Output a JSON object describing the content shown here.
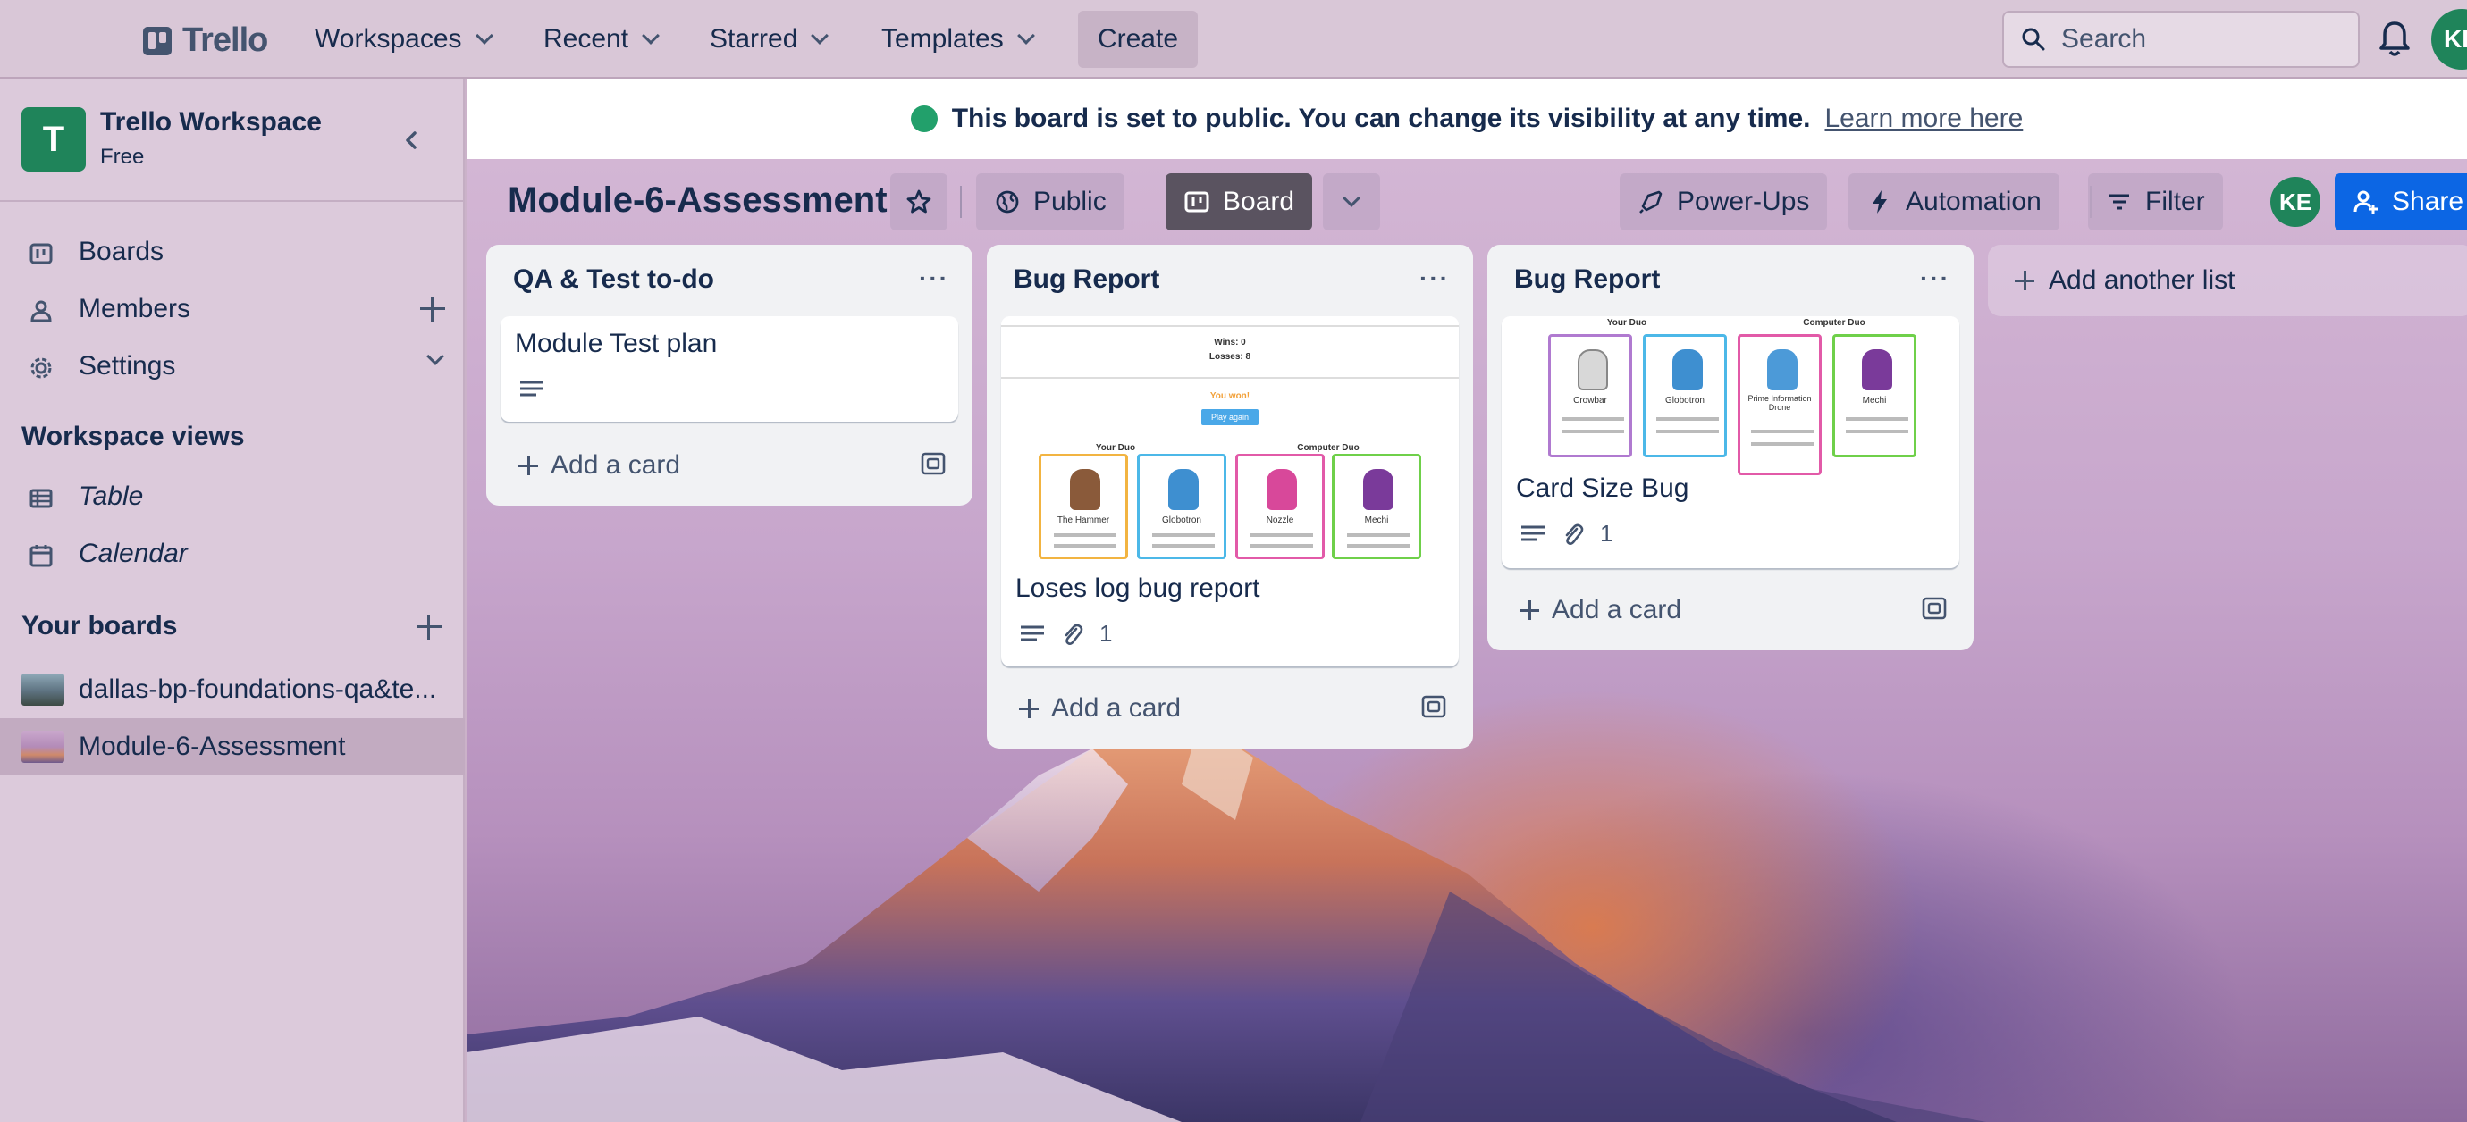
{
  "topnav": {
    "logo_text": "Trello",
    "workspaces": "Workspaces",
    "recent": "Recent",
    "starred": "Starred",
    "templates": "Templates",
    "create": "Create",
    "search_placeholder": "Search",
    "avatar_initials": "KE"
  },
  "sidebar": {
    "workspace_initial": "T",
    "workspace_name": "Trello Workspace",
    "workspace_plan": "Free",
    "items": [
      {
        "label": "Boards"
      },
      {
        "label": "Members"
      },
      {
        "label": "Settings"
      }
    ],
    "views_heading": "Workspace views",
    "views": [
      {
        "label": "Table"
      },
      {
        "label": "Calendar"
      }
    ],
    "boards_heading": "Your boards",
    "boards": [
      {
        "label": "dallas-bp-foundations-qa&te..."
      },
      {
        "label": "Module-6-Assessment"
      }
    ]
  },
  "banner": {
    "message": "This board is set to public. You can change its visibility at any time.",
    "link": "Learn more here"
  },
  "board": {
    "title": "Module-6-Assessment",
    "visibility": "Public",
    "view": "Board",
    "power_ups": "Power-Ups",
    "automation": "Automation",
    "filter": "Filter",
    "member_initials": "KE",
    "share": "Share",
    "add_list": "Add another list"
  },
  "lists": [
    {
      "title": "QA & Test to-do",
      "cards": [
        {
          "title": "Module Test plan",
          "has_description": true
        }
      ],
      "add_card": "Add a card"
    },
    {
      "title": "Bug Report",
      "cards": [
        {
          "title": "Loses log bug report",
          "has_description": true,
          "attachments": "1",
          "cover": {
            "wins": "Wins: 0",
            "losses": "Losses: 8",
            "result": "You won!",
            "button": "Play again",
            "your_duo": "Your Duo",
            "computer_duo": "Computer Duo",
            "bots": [
              "The Hammer",
              "Globotron",
              "Nozzle",
              "Mechi"
            ]
          }
        }
      ],
      "add_card": "Add a card"
    },
    {
      "title": "Bug Report",
      "cards": [
        {
          "title": "Card Size Bug",
          "has_description": true,
          "attachments": "1",
          "cover": {
            "your_duo": "Your Duo",
            "computer_duo": "Computer Duo",
            "bots": [
              "Crowbar",
              "Globotron",
              "Prime Information Drone",
              "Mechi"
            ]
          }
        }
      ],
      "add_card": "Add a card"
    }
  ],
  "colors": {
    "brand_green": "#1f845a",
    "share_blue": "#0c66e4",
    "public_green": "#22a06b",
    "mini_card_borders": [
      "#f2b441",
      "#4cb8e8",
      "#e25aa8",
      "#6fd04a"
    ]
  }
}
